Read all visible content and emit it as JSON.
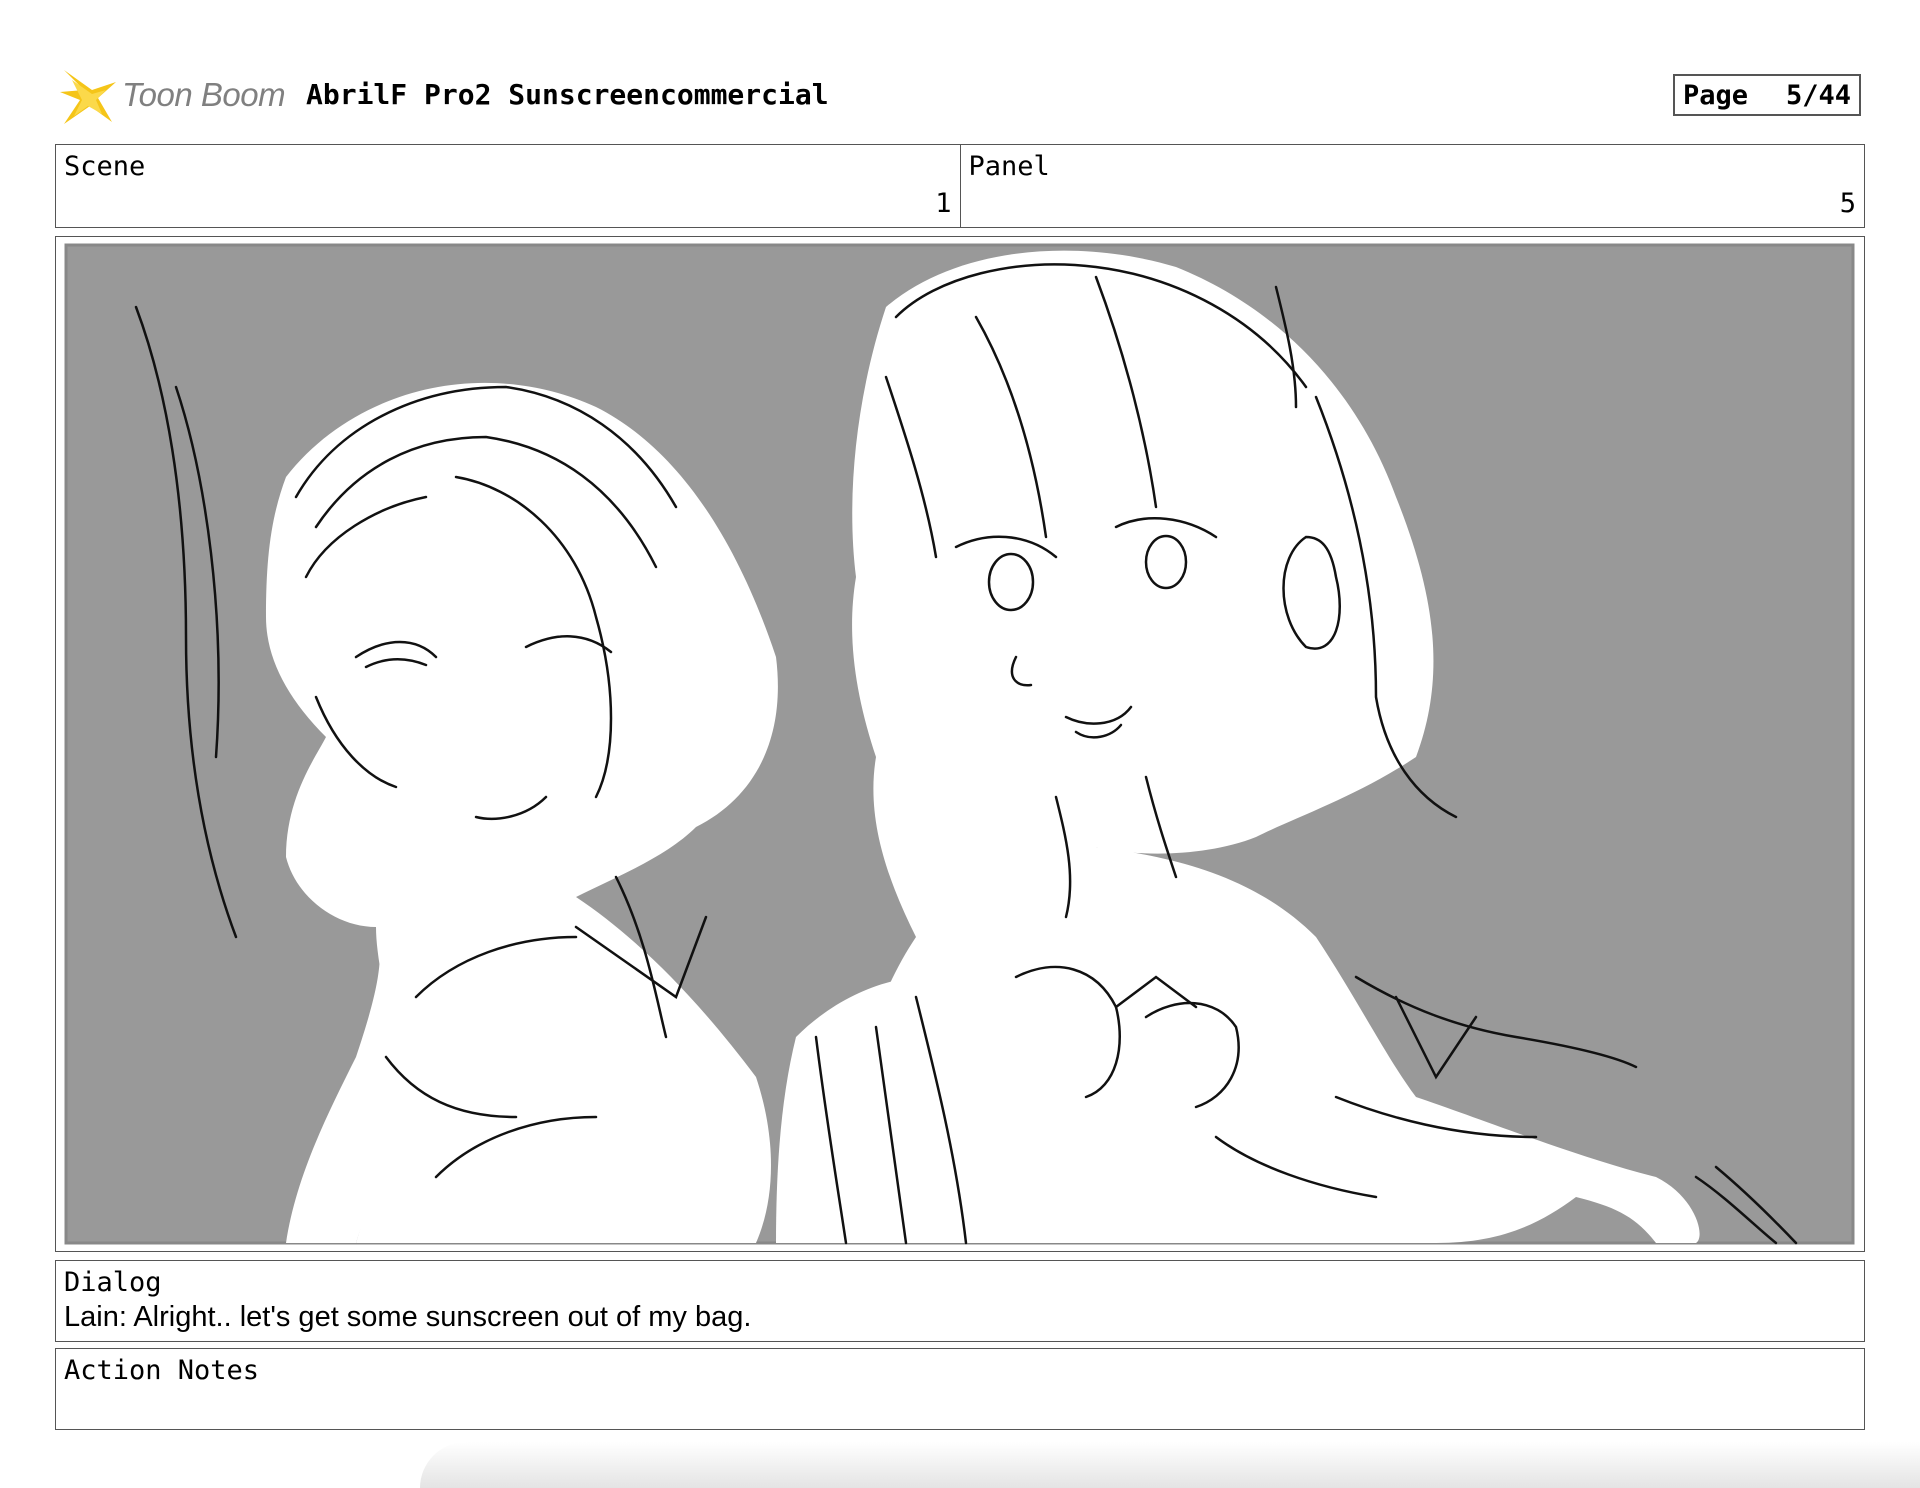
{
  "header": {
    "logo_text": "Toon Boom",
    "project_title": "AbrilF Pro2 Sunscreencommercial",
    "page_label": "Page",
    "page_number": "5/44"
  },
  "info": {
    "scene_label": "Scene",
    "scene_value": "1",
    "panel_label": "Panel",
    "panel_value": "5"
  },
  "panel_image": {
    "background_color": "#999999",
    "icon": "storyboard-sketch-two-girls"
  },
  "dialog": {
    "label": "Dialog",
    "text": "Lain: Alright.. let's get some sunscreen out of my bag."
  },
  "action_notes": {
    "label": "Action Notes",
    "text": ""
  },
  "colors": {
    "logo_star": "#f5c518",
    "logo_text": "#808080",
    "border": "#555555",
    "sketch_bg": "#999999"
  }
}
